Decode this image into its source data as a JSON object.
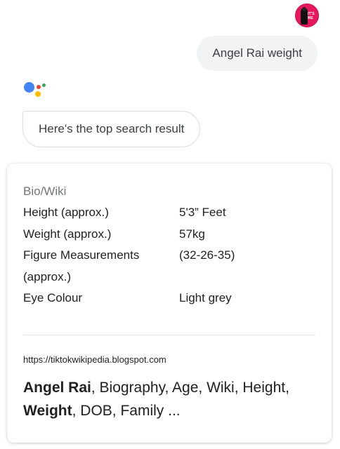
{
  "user": {
    "avatar_text": "IT'S ME",
    "query": "Angel Rai weight"
  },
  "assistant": {
    "logo_icon": "google-assistant-icon",
    "logo_colors": [
      "#4285f4",
      "#ea4335",
      "#fbbc04",
      "#34a853"
    ],
    "reply": "Here's the top search result"
  },
  "result": {
    "heading": "Bio/Wiki",
    "rows": [
      {
        "label": "Height (approx.)",
        "value": "5'3” Feet"
      },
      {
        "label": "Weight (approx.)",
        "value": "57kg"
      },
      {
        "label": "Figure Measurements",
        "value": "(32-26-35)"
      },
      {
        "label": "(approx.)",
        "value": ""
      },
      {
        "label": "Eye Colour",
        "value": "Light grey"
      }
    ],
    "source_url": "https://tiktokwikipedia.blogspot.com",
    "title_parts": {
      "p1": "Angel Rai",
      "p2": ", Biography, Age, Wiki, Height, ",
      "p3": "Weight",
      "p4": ", DOB, Family ..."
    }
  }
}
